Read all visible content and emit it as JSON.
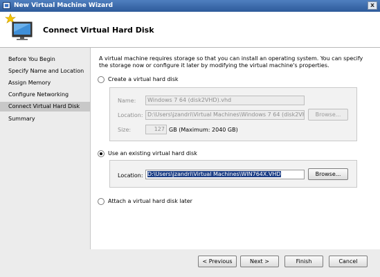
{
  "window": {
    "title": "New Virtual Machine Wizard",
    "close_glyph": "x"
  },
  "header": {
    "title": "Connect Virtual Hard Disk",
    "icon": "wizard-monitor-icon"
  },
  "nav": {
    "items": [
      {
        "label": "Before You Begin",
        "active": false
      },
      {
        "label": "Specify Name and Location",
        "active": false
      },
      {
        "label": "Assign Memory",
        "active": false
      },
      {
        "label": "Configure Networking",
        "active": false
      },
      {
        "label": "Connect Virtual Hard Disk",
        "active": true
      },
      {
        "label": "Summary",
        "active": false
      }
    ]
  },
  "intro": {
    "text": "A virtual machine requires storage so that you can install an operating system. You can specify the storage now or configure it later by modifying the virtual machine's properties."
  },
  "options": {
    "create": {
      "label": "Create a virtual hard disk",
      "selected": false,
      "name_label": "Name:",
      "name_value": "Windows 7 64 (disk2VHD).vhd",
      "location_label": "Location:",
      "location_value": "D:\\Users\\jzandri\\Virtual Machines\\Windows 7 64 (disk2VHD)",
      "browse_label": "Browse...",
      "size_label": "Size:",
      "size_value": "127",
      "size_suffix": "GB (Maximum: 2040 GB)"
    },
    "existing": {
      "label": "Use an existing virtual hard disk",
      "selected": true,
      "location_label": "Location:",
      "location_value": "D:\\Users\\jzandri\\Virtual Machines\\WIN764X.VHD",
      "browse_label": "Browse..."
    },
    "later": {
      "label": "Attach a virtual hard disk later",
      "selected": false
    }
  },
  "footer": {
    "previous_label": "< Previous",
    "next_label": "Next >",
    "finish_label": "Finish",
    "cancel_label": "Cancel"
  },
  "colors": {
    "title_bar": "#2d5a9a",
    "selection": "#1d3f86",
    "nav_active": "#c8c8c8"
  }
}
